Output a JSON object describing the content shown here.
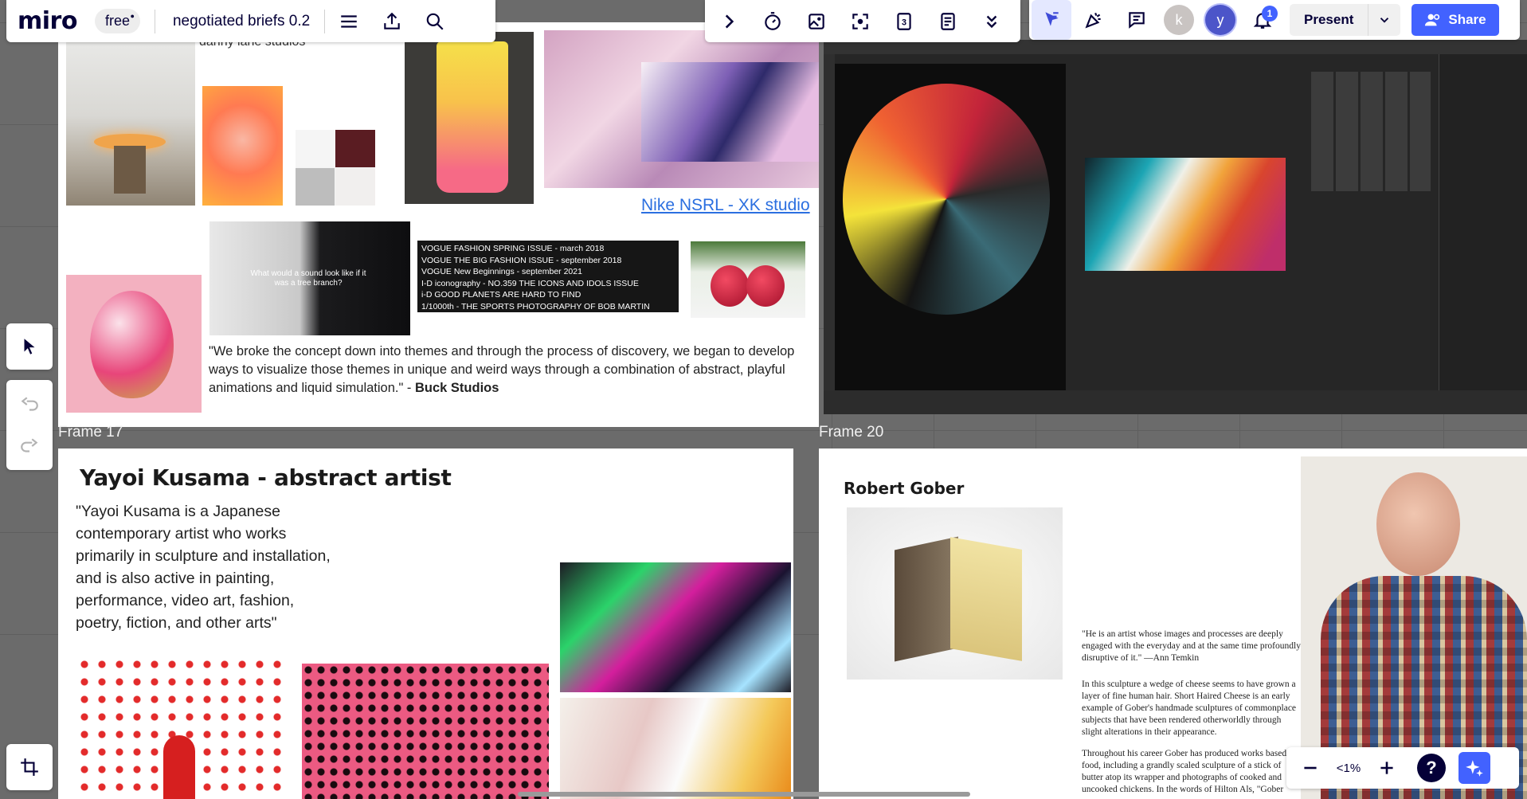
{
  "topbar": {
    "logo": "miro",
    "plan_badge": "free",
    "board_name": "negotiated briefs 0.2",
    "present_label": "Present",
    "share_label": "Share",
    "notification_count": "1",
    "avatar_k": "k",
    "avatar_y": "y",
    "accent": "#4262ff"
  },
  "board": {
    "frame_top_left": {
      "caption_danny": "danny lane studios",
      "tree_overlay_text": "What would a sound look like if it was a tree branch?",
      "vogue_lines": [
        "VOGUE FASHION SPRING ISSUE - march 2018",
        "VOGUE THE BIG FASHION ISSUE - september 2018",
        "VOGUE New Beginnings - september 2021",
        "I-D iconography - NO.359 THE ICONS AND IDOLS ISSUE",
        "i-D GOOD PLANETS ARE HARD TO FIND",
        "1/1000th - THE SPORTS PHOTOGRAPHY OF BOB MARTIN"
      ],
      "nike_link": "Nike NSRL - XK studio",
      "buck_quote": "\"We broke the concept down into themes and through the process of discovery, we began to develop ways to visualize those themes in unique and weird ways through a combination of abstract, playful animations and liquid simulation.\" - ",
      "buck_attrib": "Buck Studios"
    },
    "frame17_label": "Frame 17",
    "frame20_label": "Frame 20",
    "kusama": {
      "title": "Yayoi Kusama - abstract artist",
      "quote": "\"Yayoi Kusama is a Japanese contemporary artist who works primarily in sculpture and installation, and is also active in painting, performance, video art, fashion, poetry, fiction, and other arts\""
    },
    "gober": {
      "title": "Robert Gober",
      "quote1": "\"He is an artist whose images and processes are deeply engaged with the everyday and at the same time profoundly disruptive of it.\" —Ann Temkin",
      "para2": "In this sculpture a wedge of cheese seems to have grown a layer of fine human hair. Short Haired Cheese is an early example of Gober's handmade sculptures of commonplace subjects that have been rendered otherworldly through slight alterations in their appearance.",
      "para3": "Throughout his career Gober has produced works based on food, including a grandly scaled sculpture of a stick of butter atop its wrapper and photographs of cooked and uncooked chickens. In the words of Hilton Als, \"Gober"
    }
  },
  "zoom": {
    "level": "<1%"
  }
}
